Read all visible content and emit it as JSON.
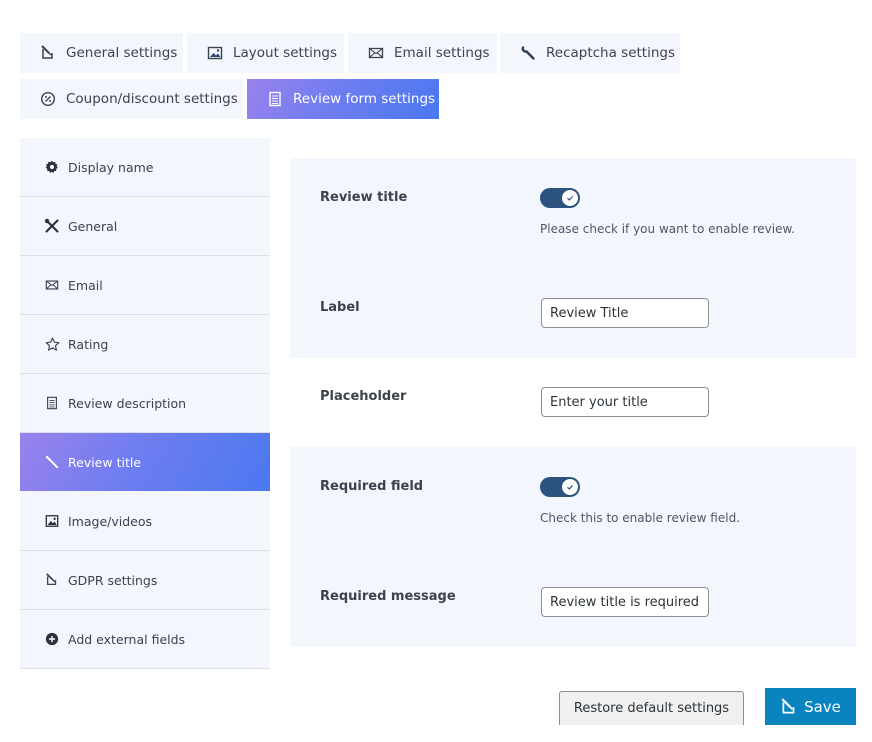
{
  "tabs": [
    {
      "label": "General settings",
      "icon": "edit-square-icon",
      "active": false
    },
    {
      "label": "Layout settings",
      "icon": "image-icon",
      "active": false
    },
    {
      "label": "Email settings",
      "icon": "envelope-icon",
      "active": false
    },
    {
      "label": "Recaptcha settings",
      "icon": "wrench-icon",
      "active": false
    },
    {
      "label": "Coupon/discount settings",
      "icon": "percent-badge-icon",
      "active": false
    },
    {
      "label": "Review form settings",
      "icon": "document-icon",
      "active": true
    }
  ],
  "sidebar": {
    "items": [
      {
        "label": "Display name",
        "icon": "gear-icon",
        "active": false
      },
      {
        "label": "General",
        "icon": "tools-icon",
        "active": false
      },
      {
        "label": "Email",
        "icon": "envelope-icon",
        "active": false
      },
      {
        "label": "Rating",
        "icon": "star-icon",
        "active": false
      },
      {
        "label": "Review description",
        "icon": "document-icon",
        "active": false
      },
      {
        "label": "Review title",
        "icon": "pencil-icon",
        "active": true
      },
      {
        "label": "Image/videos",
        "icon": "image-icon",
        "active": false
      },
      {
        "label": "GDPR settings",
        "icon": "edit-square-icon",
        "active": false
      },
      {
        "label": "Add external fields",
        "icon": "plus-circle-icon",
        "active": false
      }
    ]
  },
  "form": {
    "review_title": {
      "label": "Review title",
      "enabled": true,
      "help": "Please check if you want to enable review."
    },
    "label_field": {
      "label": "Label",
      "value": "Review Title"
    },
    "placeholder_field": {
      "label": "Placeholder",
      "value": "Enter your title"
    },
    "required_field": {
      "label": "Required field",
      "enabled": true,
      "help": "Check this to enable review field."
    },
    "required_message": {
      "label": "Required message",
      "value": "Review title is required"
    }
  },
  "footer": {
    "restore_label": "Restore default settings",
    "save_label": "Save"
  },
  "colors": {
    "accent_gradient_start": "#9a82ec",
    "accent_gradient_end": "#4a78f0",
    "panel_bg": "#f3f6fd",
    "toggle_on": "#2c5280",
    "save_button": "#0a84bf"
  }
}
